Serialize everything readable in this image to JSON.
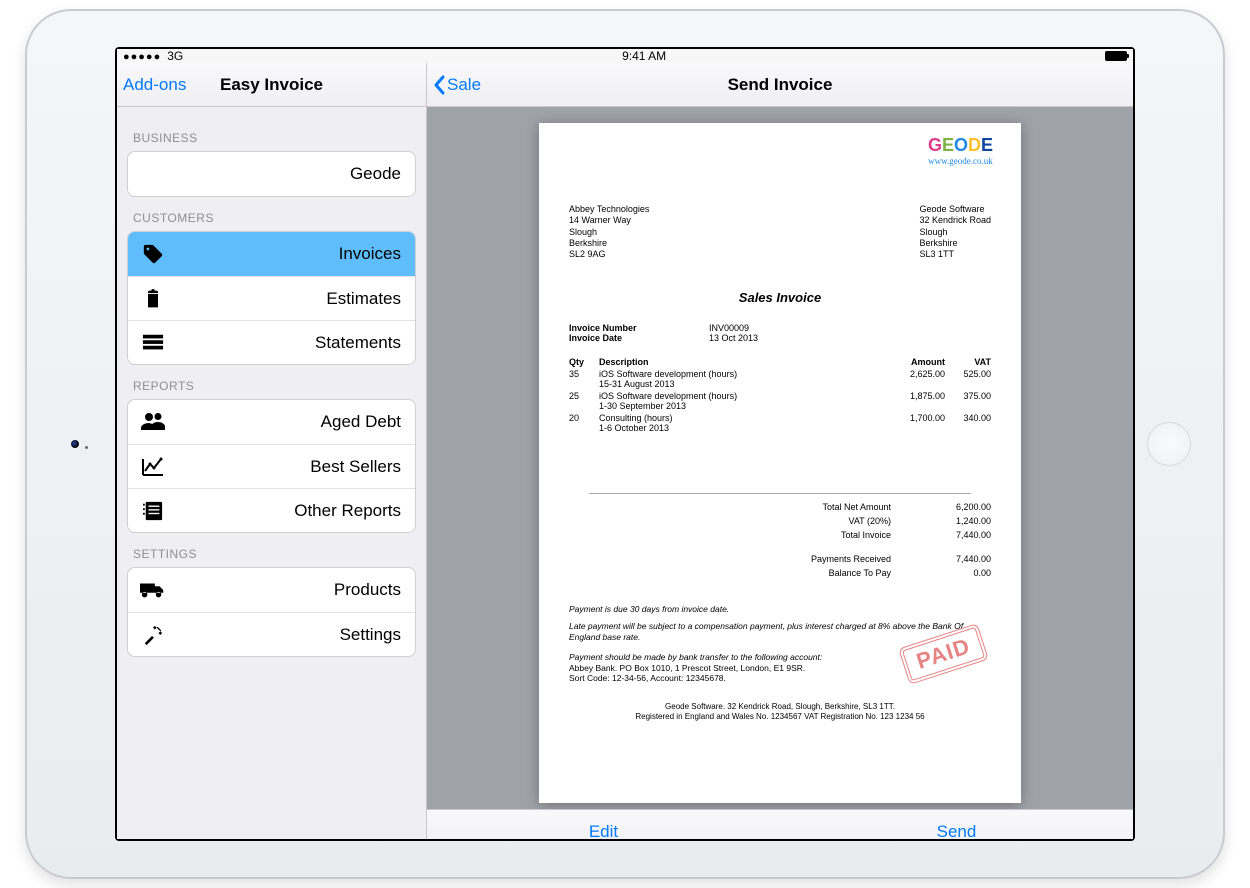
{
  "status": {
    "carrier": "3G",
    "time": "9:41 AM"
  },
  "master": {
    "navLeft": "Add-ons",
    "title": "Easy Invoice",
    "biz_header": "BUSINESS",
    "biz_name": "Geode",
    "cust_header": "CUSTOMERS",
    "cust_items": [
      "Invoices",
      "Estimates",
      "Statements"
    ],
    "rep_header": "REPORTS",
    "rep_items": [
      "Aged Debt",
      "Best Sellers",
      "Other Reports"
    ],
    "set_header": "SETTINGS",
    "set_items": [
      "Products",
      "Settings"
    ]
  },
  "detail": {
    "navBack": "Sale",
    "navTitle": "Send Invoice",
    "toolbar": {
      "edit": "Edit",
      "send": "Send"
    }
  },
  "invoice": {
    "logo_url": "www.geode.co.uk",
    "bill_to": [
      "Abbey Technologies",
      "14 Warner Way",
      "Slough",
      "Berkshire",
      "SL2 9AG"
    ],
    "from": [
      "Geode Software",
      "32 Kendrick Road",
      "Slough",
      "Berkshire",
      "SL3 1TT"
    ],
    "title": "Sales Invoice",
    "meta": {
      "num_label": "Invoice Number",
      "num": "INV00009",
      "date_label": "Invoice Date",
      "date": "13 Oct 2013"
    },
    "head": {
      "qty": "Qty",
      "desc": "Description",
      "amt": "Amount",
      "vat": "VAT"
    },
    "items": [
      {
        "qty": "35",
        "desc": "iOS Software development (hours)",
        "sub": "15-31 August 2013",
        "amt": "2,625.00",
        "vat": "525.00"
      },
      {
        "qty": "25",
        "desc": "iOS Software development (hours)",
        "sub": "1-30 September 2013",
        "amt": "1,875.00",
        "vat": "375.00"
      },
      {
        "qty": "20",
        "desc": "Consulting (hours)",
        "sub": "1-6 October 2013",
        "amt": "1,700.00",
        "vat": "340.00"
      }
    ],
    "totals": [
      {
        "label": "Total Net Amount",
        "value": "6,200.00"
      },
      {
        "label": "VAT (20%)",
        "value": "1,240.00"
      },
      {
        "label": "Total Invoice",
        "value": "7,440.00"
      },
      {
        "label": "Payments Received",
        "value": "7,440.00"
      },
      {
        "label": "Balance To Pay",
        "value": "0.00"
      }
    ],
    "stamp": "PAID",
    "notes": [
      "Payment is due 30 days from invoice date.",
      "Late payment will be subject to a compensation payment, plus interest charged at 8% above the Bank Of England base rate.",
      "Payment should be made by bank transfer to the following account:",
      "Abbey Bank. PO Box 1010, 1 Prescot Street, London, E1 9SR.",
      "Sort Code: 12-34-56, Account: 12345678."
    ],
    "footer1": "Geode Software. 32 Kendrick Road, Slough, Berkshire, SL3 1TT.",
    "footer2": "Registered in England and Wales No. 1234567   VAT Registration No. 123 1234 56"
  }
}
